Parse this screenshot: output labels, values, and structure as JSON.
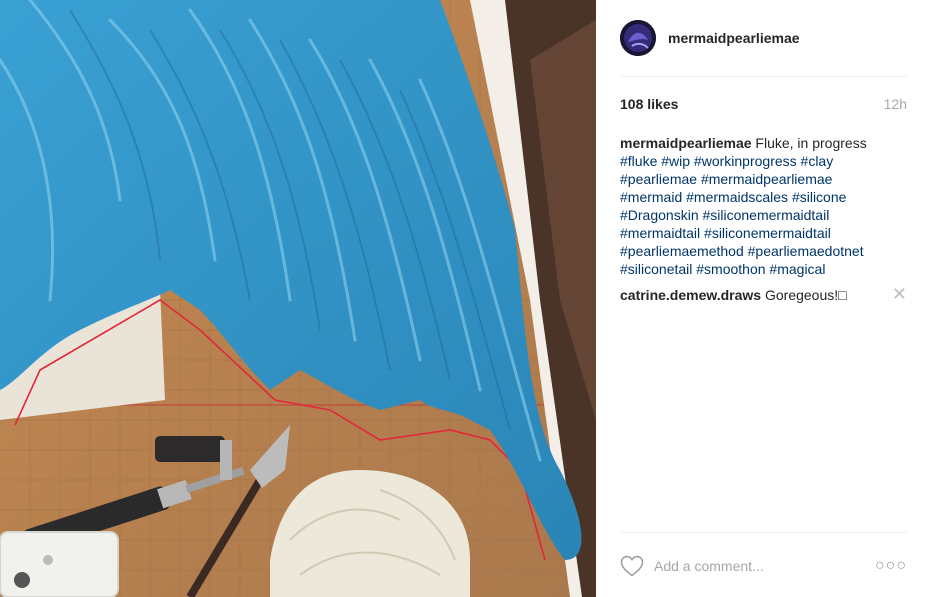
{
  "post": {
    "username": "mermaidpearliemae",
    "likes": "108 likes",
    "time": "12h",
    "caption_user": "mermaidpearliemae",
    "caption_text": "Fluke, in progress",
    "hashtag_lines": [
      "#fluke #wip #workinprogress #clay",
      "#pearliemae #mermaidpearliemae",
      "#mermaid #mermaidscales #silicone",
      "#Dragonskin #siliconemermaidtail",
      "#mermaidtail #siliconemermaidtail",
      "#pearliemaemethod #pearliemaedotnet",
      "#siliconetail #smoothon #magical"
    ]
  },
  "comments": [
    {
      "user": "catrine.demew.draws",
      "text": "Goregeous!□"
    }
  ],
  "footer": {
    "comment_placeholder": "Add a comment...",
    "more_label": "○○○"
  },
  "icons": {
    "like": "heart-icon",
    "remove": "close-icon",
    "more": "more-options-icon"
  },
  "colors": {
    "text": "#262626",
    "hashtag": "#003569",
    "muted": "#a5a7aa",
    "fluke": "#2f93c9",
    "mat": "#c0874f"
  }
}
